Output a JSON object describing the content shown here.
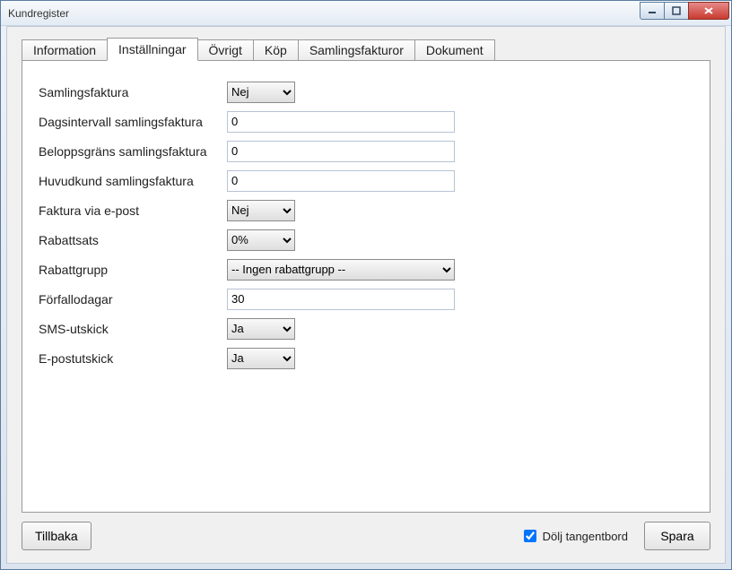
{
  "window": {
    "title": "Kundregister"
  },
  "tabs": [
    {
      "label": "Information"
    },
    {
      "label": "Inställningar"
    },
    {
      "label": "Övrigt"
    },
    {
      "label": "Köp"
    },
    {
      "label": "Samlingsfakturor"
    },
    {
      "label": "Dokument"
    }
  ],
  "active_tab_index": 1,
  "form": {
    "samlingsfaktura": {
      "label": "Samlingsfaktura",
      "value": "Nej"
    },
    "dagsintervall": {
      "label": "Dagsintervall samlingsfaktura",
      "value": "0"
    },
    "beloppsgrans": {
      "label": "Beloppsgräns samlingsfaktura",
      "value": "0"
    },
    "huvudkund": {
      "label": "Huvudkund samlingsfaktura",
      "value": "0"
    },
    "faktura_epost": {
      "label": "Faktura via e-post",
      "value": "Nej"
    },
    "rabattsats": {
      "label": "Rabattsats",
      "value": "0%"
    },
    "rabattgrupp": {
      "label": "Rabattgrupp",
      "value": "-- Ingen rabattgrupp --"
    },
    "forfallodagar": {
      "label": "Förfallodagar",
      "value": "30"
    },
    "sms_utskick": {
      "label": "SMS-utskick",
      "value": "Ja"
    },
    "epost_utskick": {
      "label": "E-postutskick",
      "value": "Ja"
    }
  },
  "footer": {
    "back": "Tillbaka",
    "hide_keyboard": "Dölj tangentbord",
    "hide_keyboard_checked": true,
    "save": "Spara"
  }
}
